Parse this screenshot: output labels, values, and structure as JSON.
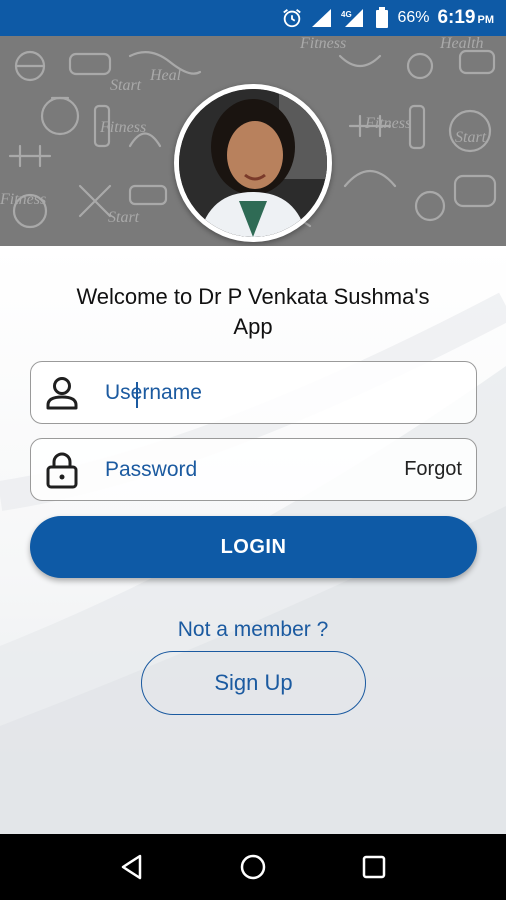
{
  "status_bar": {
    "battery": "66%",
    "network": "4G",
    "time": "6:19",
    "ampm": "PM"
  },
  "hero": {
    "avatar_alt": "profile photo"
  },
  "welcome": {
    "line1": "Welcome to Dr P Venkata Sushma's",
    "line2": "App"
  },
  "form": {
    "username_placeholder": "Username",
    "password_placeholder": "Password",
    "forgot_label": "Forgot",
    "login_label": "LOGIN"
  },
  "signup_section": {
    "prompt": "Not a member ?",
    "button_label": "Sign Up"
  },
  "colors": {
    "primary": "#0e5aa6",
    "link": "#1b5aa0"
  }
}
